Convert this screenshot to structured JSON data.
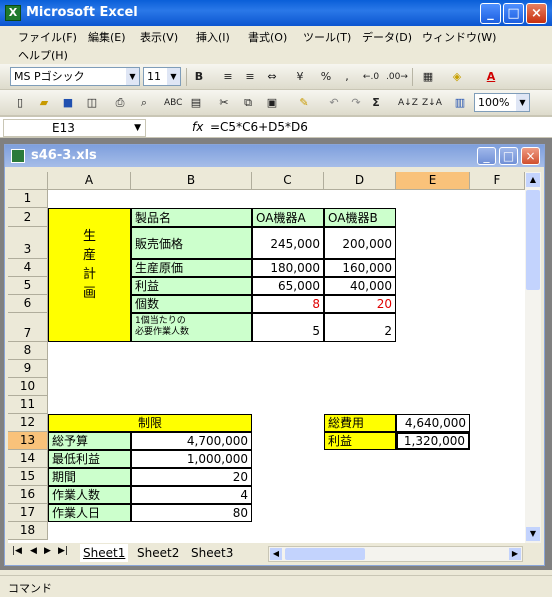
{
  "app": {
    "title": "Microsoft Excel"
  },
  "menu": [
    "ファイル(F)",
    "編集(E)",
    "表示(V)",
    "挿入(I)",
    "書式(O)",
    "ツール(T)",
    "データ(D)",
    "ウィンドウ(W)",
    "ヘルプ(H)"
  ],
  "format_toolbar": {
    "font": "MS Pゴシック",
    "size": "11"
  },
  "std_toolbar": {
    "zoom": "100%"
  },
  "formula_bar": {
    "name_box": "E13",
    "fx": "fx",
    "formula": "=C5*C6+D5*D6"
  },
  "workbook": {
    "title": "s46-3.xls"
  },
  "columns": [
    "A",
    "B",
    "C",
    "D",
    "E",
    "F"
  ],
  "rows": [
    "1",
    "2",
    "3",
    "4",
    "5",
    "6",
    "7",
    "8",
    "9",
    "10",
    "11",
    "12",
    "13",
    "14",
    "15",
    "16",
    "17",
    "18"
  ],
  "cells": {
    "a_vertical": "生\n産\n計\n画",
    "b2": "製品名",
    "c2": "OA機器A",
    "d2": "OA機器B",
    "b3": "販売価格",
    "c3": "245,000",
    "d3": "200,000",
    "b4": "生産原価",
    "c4": "180,000",
    "d4": "160,000",
    "b5": "利益",
    "c5": "65,000",
    "d5": "40,000",
    "b6": "個数",
    "c6": "8",
    "d6": "20",
    "b7": "1個当たりの\n必要作業人数",
    "c7": "5",
    "d7": "2",
    "ab12": "制限",
    "a13": "総予算",
    "b13": "4,700,000",
    "a14": "最低利益",
    "b14": "1,000,000",
    "a15": "期間",
    "b15": "20",
    "a16": "作業人数",
    "b16": "4",
    "a17": "作業人日",
    "b17": "80",
    "d12": "総費用",
    "e12": "4,640,000",
    "d13": "利益",
    "e13": "1,320,000"
  },
  "sheets": [
    "Sheet1",
    "Sheet2",
    "Sheet3"
  ],
  "status": "コマンド"
}
